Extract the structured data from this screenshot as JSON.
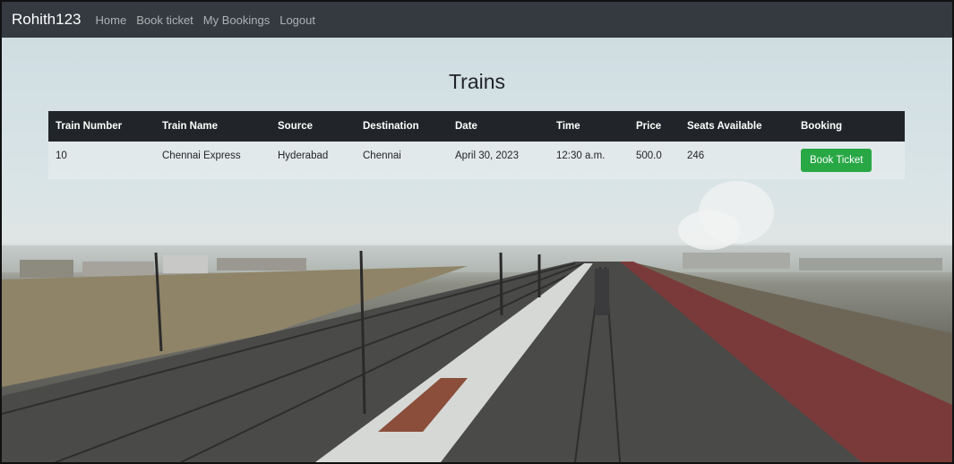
{
  "navbar": {
    "brand": "Rohith123",
    "links": [
      "Home",
      "Book ticket",
      "My Bookings",
      "Logout"
    ]
  },
  "page": {
    "title": "Trains"
  },
  "table": {
    "headers": [
      "Train Number",
      "Train Name",
      "Source",
      "Destination",
      "Date",
      "Time",
      "Price",
      "Seats Available",
      "Booking"
    ],
    "rows": [
      {
        "train_number": "10",
        "train_name": "Chennai Express",
        "source": "Hyderabad",
        "destination": "Chennai",
        "date": "April 30, 2023",
        "time": "12:30 a.m.",
        "price": "500.0",
        "seats": "246",
        "booking_label": "Book Ticket"
      }
    ]
  },
  "colors": {
    "navbar": "#343a40",
    "table_header": "#212529",
    "button": "#28a745"
  }
}
